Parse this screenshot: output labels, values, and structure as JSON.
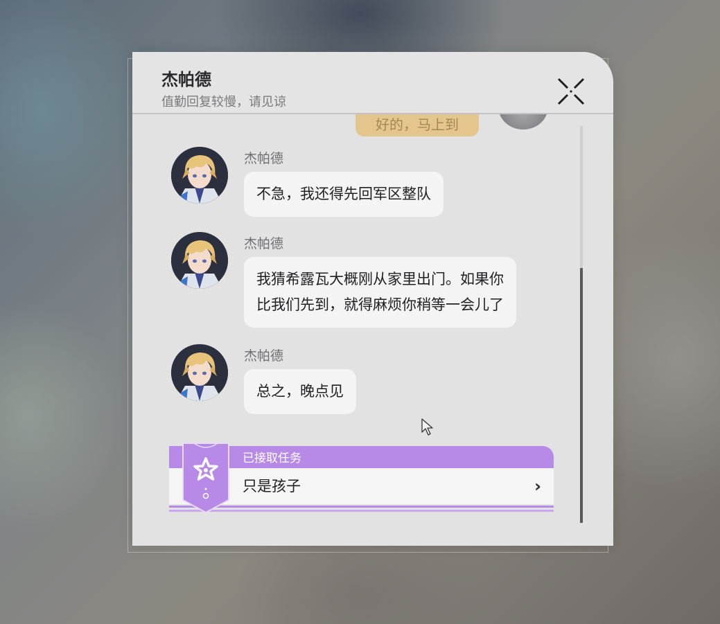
{
  "chat": {
    "title": "杰帕德",
    "subtitle": "值勤回复较慢，请见谅",
    "previous_reply": "好的，马上到"
  },
  "messages": [
    {
      "sender": "杰帕德",
      "text": "不急，我还得先回军区整队"
    },
    {
      "sender": "杰帕德",
      "text_lines": [
        "我猜希露瓦大概刚从家里出门。如果你",
        "比我们先到，就得麻烦你稍等一会儿了"
      ]
    },
    {
      "sender": "杰帕德",
      "text": "总之，晚点见"
    }
  ],
  "quest": {
    "status": "已接取任务",
    "name": "只是孩子",
    "chevron": "›"
  },
  "scroll_position": 0.36,
  "colors": {
    "panel": "#e2e2e3",
    "bubble": "#f4f4f5",
    "quest_accent": "#b88ae8",
    "reply_bubble": "#e4c58c"
  },
  "icons": {
    "close": "x-cross-icon",
    "quest": "star-badge-icon"
  }
}
